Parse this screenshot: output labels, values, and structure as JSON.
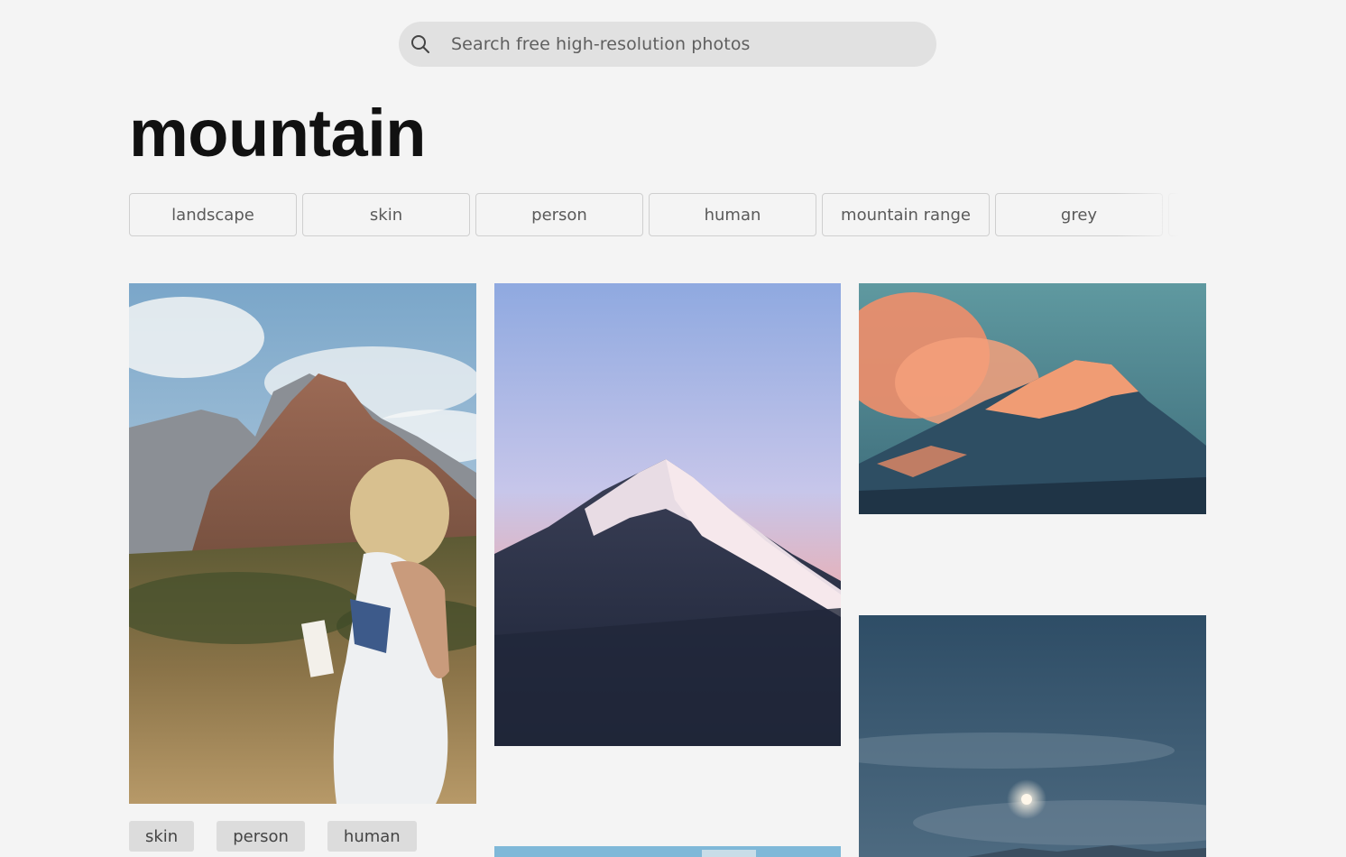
{
  "search": {
    "placeholder": "Search free high-resolution photos",
    "icon": "search-icon"
  },
  "page": {
    "title": "mountain"
  },
  "related_tags": [
    "landscape",
    "skin",
    "person",
    "human",
    "mountain range",
    "grey",
    ""
  ],
  "photo_tags": [
    "skin",
    "person",
    "human"
  ],
  "colors": {
    "background": "#f4f4f4",
    "search_bg": "#e1e1e1",
    "tag_border": "#cfcfcf",
    "photo_tag_bg": "#dcdcdc"
  }
}
